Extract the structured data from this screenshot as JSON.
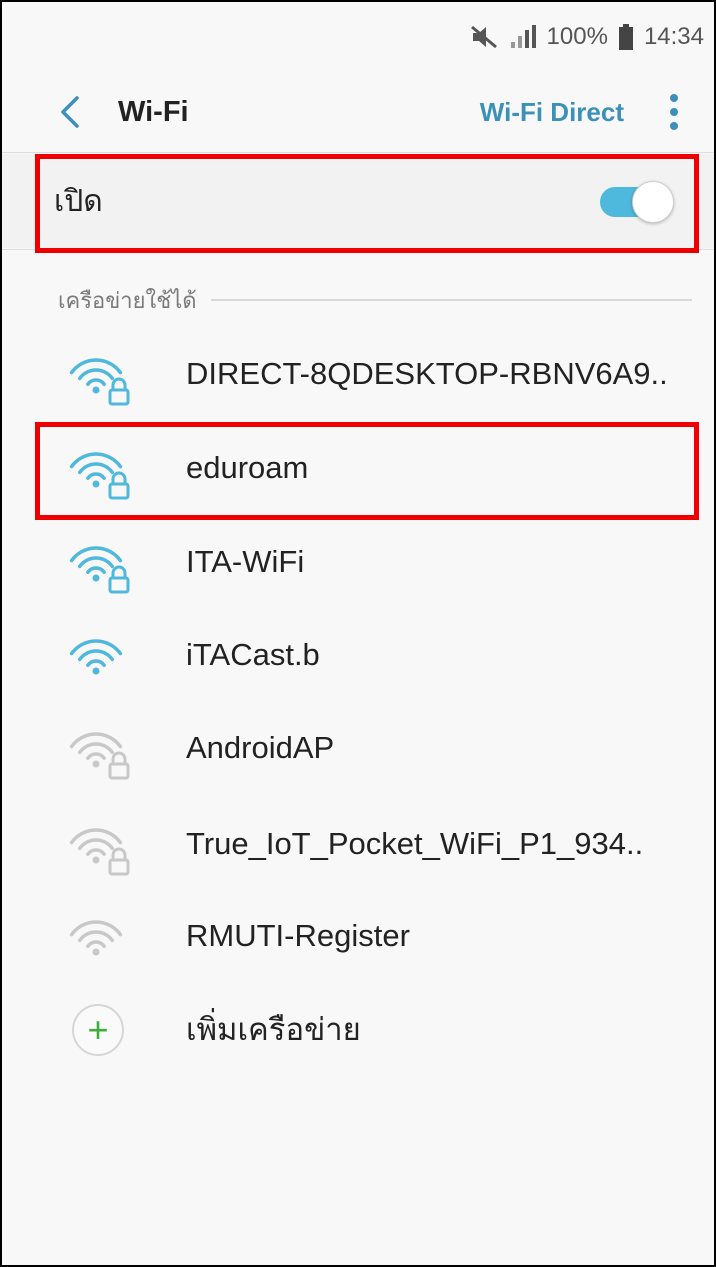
{
  "status_bar": {
    "battery": "100%",
    "time": "14:34",
    "icons": [
      "mute-icon",
      "signal-icon",
      "battery-icon"
    ]
  },
  "app_bar": {
    "title": "Wi-Fi",
    "wifi_direct_label": "Wi-Fi Direct",
    "back_icon": "back-chevron-icon",
    "more_icon": "more-vert-icon"
  },
  "toggle": {
    "label": "เปิด",
    "state": "on"
  },
  "section": {
    "title": "เครือข่ายใช้ได้"
  },
  "networks": [
    {
      "name": "DIRECT-8QDESKTOP-RBNV6A9..",
      "strength": "full",
      "secured": true
    },
    {
      "name": "eduroam",
      "strength": "full",
      "secured": true
    },
    {
      "name": "ITA-WiFi",
      "strength": "full",
      "secured": true
    },
    {
      "name": "iTACast.b",
      "strength": "full",
      "secured": false
    },
    {
      "name": "AndroidAP",
      "strength": "weak",
      "secured": true
    },
    {
      "name": "True_IoT_Pocket_WiFi_P1_934..",
      "strength": "weak",
      "secured": true
    },
    {
      "name": "RMUTI-Register",
      "strength": "weak",
      "secured": false
    }
  ],
  "add_network": {
    "label": "เพิ่มเครือข่าย"
  },
  "colors": {
    "accent": "#3d90b8",
    "wifi_strong": "#4fb8dd",
    "wifi_weak": "#c8c8c8",
    "highlight": "#ee0000",
    "add": "#3dae3d"
  }
}
